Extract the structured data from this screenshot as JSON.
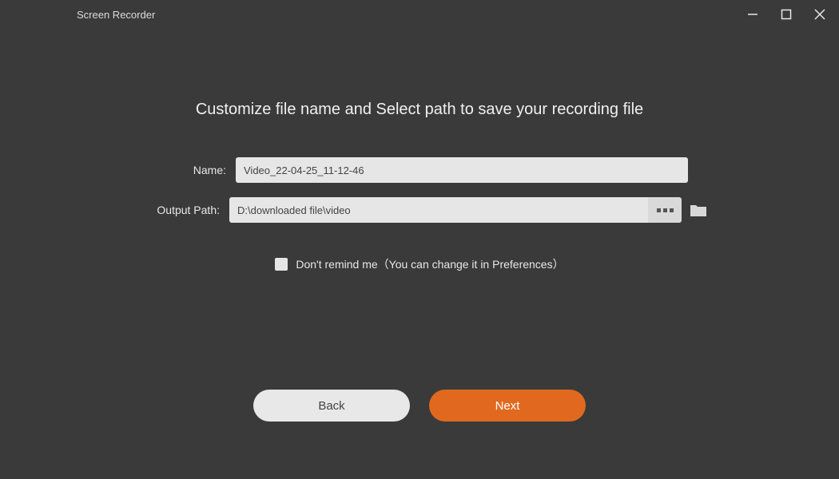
{
  "titlebar": {
    "title": "Screen Recorder"
  },
  "heading": "Customize file name and Select path to save your recording file",
  "form": {
    "name_label": "Name:",
    "name_value": "Video_22-04-25_11-12-46",
    "output_label": "Output Path:",
    "output_value": "D:\\downloaded file\\video"
  },
  "remind": {
    "label": "Don't remind me（You can change it in Preferences）"
  },
  "buttons": {
    "back": "Back",
    "next": "Next"
  },
  "colors": {
    "bg": "#3a3a3a",
    "accent": "#e0691f",
    "input_bg": "#e6e6e6",
    "btn_light": "#e8e8e8"
  }
}
